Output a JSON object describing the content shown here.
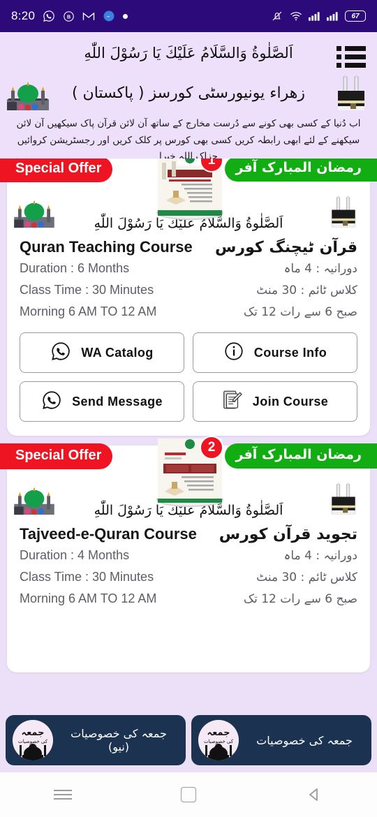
{
  "status_bar": {
    "time": "8:20",
    "battery_level": "67",
    "icons": [
      "whatsapp-icon",
      "b-app-icon",
      "gmail-icon",
      "messenger-icon",
      "dot-indicator"
    ],
    "right_icons": [
      "vibrate-icon",
      "wifi-icon",
      "signal-icon-1",
      "signal-icon-2",
      "battery-icon"
    ],
    "background_color": "#2c0a7a"
  },
  "header": {
    "calligraphy": "اَلصَّلٰوةُ وَالسَّلَامُ عَلَيْكَ يَا رَسُوْلَ اللّٰهِ",
    "title_urdu": "زهراء يونيورسٹی کورسز ( پاکستان )",
    "description_line1": "اب دُنیا کے کسی بھی کونے سے دُرست مخارج کے ساتھ آن لائن قرآن پاک سیکھیں آن لائن",
    "description_line2": "سیکھنے کے لئے ابھی رابطہ کریں کسی بھی کورس پر کلک کریں اور رجسٹریشن کروائیں جزاک اللہ خیرا",
    "menu_icon": "list-menu-icon",
    "mosque_icon": "green-dome-mosque-icon",
    "kaaba_icon": "kaaba-icon",
    "background_color": "#eee0fb"
  },
  "theme": {
    "page_background": "#ece0f8",
    "card_background": "#ffffff",
    "offer_red": "#ef1421",
    "offer_green": "#12ad12",
    "jumma_navy": "#1b3350"
  },
  "courses": [
    {
      "badge_number": "1",
      "ribbon_left": "Special Offer",
      "ribbon_right": "رمضان المبارک آفر",
      "calligraphy": "اَلصَّلٰوةُ وَالسَّلَامُ عَلَيْكَ يَا رَسُوْلَ اللّٰهِ",
      "title_en": "Quran Teaching Course",
      "title_ur": "قرآن ٹیچنگ کورس",
      "details": [
        {
          "en": "Duration : 6 Months",
          "ur": "دورانیہ : 4 ماہ"
        },
        {
          "en": "Class Time : 30 Minutes",
          "ur": "کلاس ٹائم : 30 منٹ"
        },
        {
          "en": "Morning 6 AM TO 12 AM",
          "ur": "صبح 6 سے رات 12 تک"
        }
      ],
      "buttons": [
        {
          "label": "WA Catalog",
          "icon": "whatsapp-icon"
        },
        {
          "label": "Course Info",
          "icon": "info-icon"
        },
        {
          "label": "Send Message",
          "icon": "whatsapp-icon"
        },
        {
          "label": "Join Course",
          "icon": "document-edit-icon"
        }
      ]
    },
    {
      "badge_number": "2",
      "ribbon_left": "Special Offer",
      "ribbon_right": "رمضان المبارک آفر",
      "calligraphy": "اَلصَّلٰوةُ وَالسَّلَامُ عَلَيْكَ يَا رَسُوْلَ اللّٰهِ",
      "title_en": "Tajveed-e-Quran Course",
      "title_ur": "تجوید قرآن کورس",
      "details": [
        {
          "en": "Duration : 4 Months",
          "ur": "دورانیہ : 4 ماہ"
        },
        {
          "en": "Class Time : 30 Minutes",
          "ur": "کلاس ٹائم : 30 منٹ"
        },
        {
          "en": "Morning 6 AM TO 12 AM",
          "ur": "صبح 6 سے رات 12 تک"
        }
      ],
      "buttons": []
    }
  ],
  "bottom_bar": {
    "buttons": [
      {
        "label": "جمعہ کی خصوصیات (نیو)",
        "logo": "jumma-logo-icon"
      },
      {
        "label": "جمعہ کی خصوصیات",
        "logo": "jumma-logo-icon"
      }
    ]
  },
  "nav_bar": {
    "recents": "recents-icon",
    "home": "home-icon",
    "back": "back-icon"
  }
}
